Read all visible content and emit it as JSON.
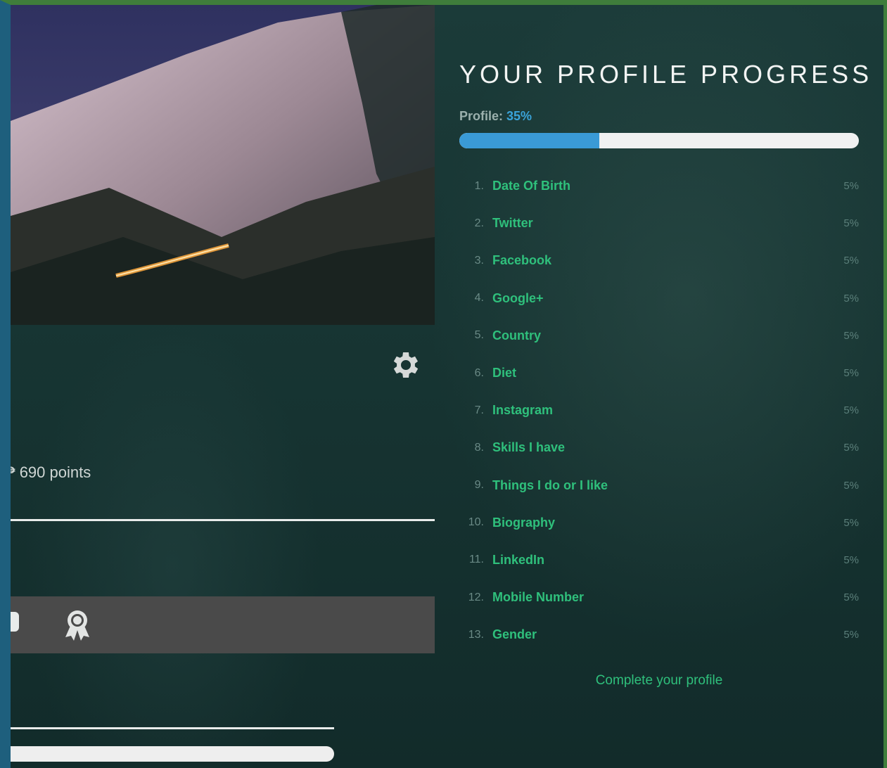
{
  "user": {
    "points_text": "690 points"
  },
  "progress_panel": {
    "title": "YOUR PROFILE PROGRESS",
    "profile_label": "Profile:",
    "profile_percent_text": "35%",
    "profile_percent": 35,
    "items": [
      {
        "num": "1.",
        "label": "Date Of Birth",
        "value": "5%"
      },
      {
        "num": "2.",
        "label": "Twitter",
        "value": "5%"
      },
      {
        "num": "3.",
        "label": "Facebook",
        "value": "5%"
      },
      {
        "num": "4.",
        "label": "Google+",
        "value": "5%"
      },
      {
        "num": "5.",
        "label": "Country",
        "value": "5%"
      },
      {
        "num": "6.",
        "label": "Diet",
        "value": "5%"
      },
      {
        "num": "7.",
        "label": "Instagram",
        "value": "5%"
      },
      {
        "num": "8.",
        "label": "Skills I have",
        "value": "5%"
      },
      {
        "num": "9.",
        "label": "Things I do or I like",
        "value": "5%"
      },
      {
        "num": "10.",
        "label": "Biography",
        "value": "5%"
      },
      {
        "num": "11.",
        "label": "LinkedIn",
        "value": "5%"
      },
      {
        "num": "12.",
        "label": "Mobile Number",
        "value": "5%"
      },
      {
        "num": "13.",
        "label": "Gender",
        "value": "5%"
      }
    ],
    "complete_link": "Complete your profile"
  },
  "icons": {
    "settings": "gear-icon",
    "points": "coin-icon",
    "badge": "award-ribbon-icon"
  },
  "colors": {
    "accent_green": "#2fc07c",
    "progress_blue": "#3a9ad6",
    "panel_bg": "#173433"
  }
}
